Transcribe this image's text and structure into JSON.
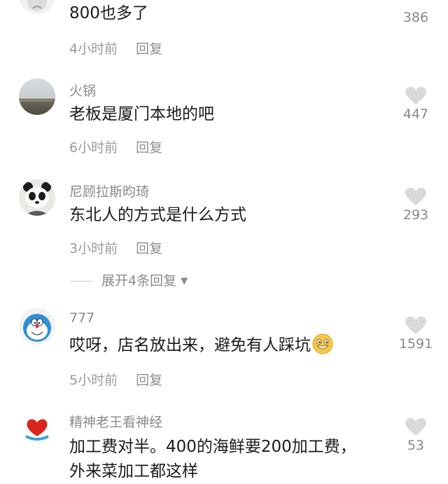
{
  "comments": [
    {
      "username": "",
      "text": "800也多了",
      "time": "4小时前",
      "reply": "回复",
      "likes": "386"
    },
    {
      "username": "火锅",
      "text": "老板是厦门本地的吧",
      "time": "6小时前",
      "reply": "回复",
      "likes": "447"
    },
    {
      "username": "尼顾拉斯昀琦",
      "text": "东北人的方式是什么方式",
      "time": "3小时前",
      "reply": "回复",
      "likes": "293",
      "expand_replies": "展开4条回复"
    },
    {
      "username": "777",
      "text": "哎呀，店名放出来，避免有人踩坑",
      "emoji": "grinning-face-emoji",
      "time": "5小时前",
      "reply": "回复",
      "likes": "1591"
    },
    {
      "username": "精神老王看神经",
      "text": "加工费对半。400的海鲜要200加工费，外来菜加工都这样",
      "likes": "53"
    }
  ],
  "colors": {
    "secondary_text": "#8a8a8a",
    "heart": "#d9d9d9",
    "body_text": "#1b1b1b"
  }
}
